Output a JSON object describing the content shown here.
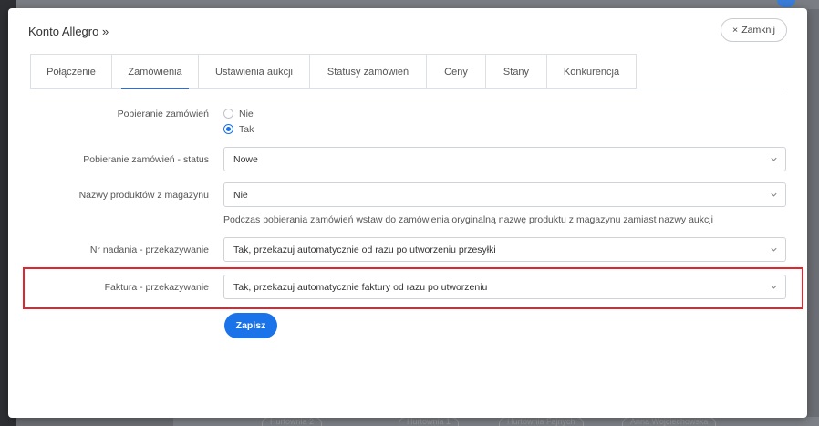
{
  "modal": {
    "title": "Konto Allegro »",
    "close_label": "Zamknij"
  },
  "tabs": [
    {
      "label": "Połączenie"
    },
    {
      "label": "Zamówienia"
    },
    {
      "label": "Ustawienia aukcji"
    },
    {
      "label": "Statusy zamówień"
    },
    {
      "label": "Ceny"
    },
    {
      "label": "Stany"
    },
    {
      "label": "Konkurencja"
    }
  ],
  "form": {
    "orders_fetch": {
      "label": "Pobieranie zamówień",
      "options": [
        "Nie",
        "Tak"
      ],
      "selected": "Tak"
    },
    "orders_status": {
      "label": "Pobieranie zamówień - status",
      "value": "Nowe"
    },
    "product_names": {
      "label": "Nazwy produktów z magazynu",
      "value": "Nie",
      "hint": "Podczas pobierania zamówień wstaw do zamówienia oryginalną nazwę produktu z magazynu zamiast nazwy aukcji"
    },
    "tracking": {
      "label": "Nr nadania - przekazywanie",
      "value": "Tak, przekazuj automatycznie od razu po utworzeniu przesyłki"
    },
    "invoice": {
      "label": "Faktura - przekazywanie",
      "value": "Tak, przekazuj automatycznie faktury od razu po utworzeniu"
    },
    "save_label": "Zapisz"
  },
  "background": {
    "chips": [
      "Hurtownia 2",
      "Hurtownia 1",
      "Hurtownia Fajnych",
      "Anna Wojciechowska"
    ]
  },
  "colors": {
    "accent": "#1a73e8",
    "highlight": "#e0262e"
  }
}
